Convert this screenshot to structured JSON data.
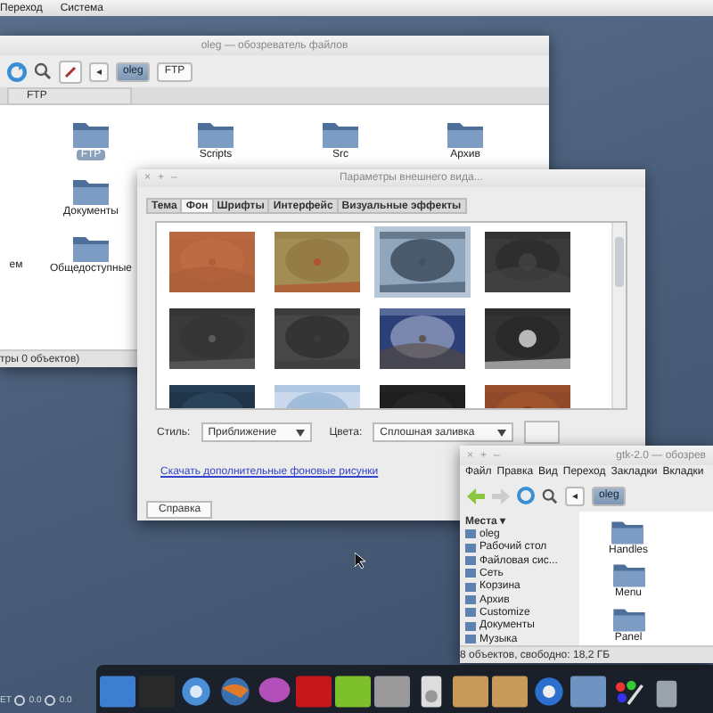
{
  "top_panel": {
    "menus": [
      "Переход",
      "Система"
    ]
  },
  "file_window": {
    "title": "oleg — обозреватель файлов",
    "path_buttons": [
      {
        "label": "◂",
        "selected": false
      },
      {
        "label": "oleg",
        "selected": true
      },
      {
        "label": "FTP",
        "selected": false
      }
    ],
    "tabs": [
      {
        "label": "FTP",
        "selected": true
      }
    ],
    "columns": [
      [
        {
          "label": "ем",
          "selected": false
        }
      ],
      [
        {
          "label": "FTP",
          "selected": true
        },
        {
          "label": "Документы",
          "selected": false
        },
        {
          "label": "Общедоступные",
          "selected": false
        }
      ],
      [
        {
          "label": "Scripts",
          "selected": false
        }
      ],
      [
        {
          "label": "Src",
          "selected": false
        }
      ],
      [
        {
          "label": "Архив",
          "selected": false
        }
      ]
    ],
    "status": "тры 0 объектов)"
  },
  "appearance_dialog": {
    "title": "Параметры внешнего вида...",
    "controls": [
      "×",
      "+",
      "–"
    ],
    "tabs": [
      {
        "label": "Тема",
        "selected": false
      },
      {
        "label": "Фон",
        "selected": true
      },
      {
        "label": "Шрифты",
        "selected": false
      },
      {
        "label": "Интерфейс",
        "selected": false
      },
      {
        "label": "Визуальные эффекты",
        "selected": false
      }
    ],
    "backgrounds": [
      {
        "selected": false
      },
      {
        "selected": false
      },
      {
        "selected": true
      },
      {
        "selected": false
      },
      {
        "selected": false
      },
      {
        "selected": false
      },
      {
        "selected": false
      },
      {
        "selected": false
      },
      {
        "selected": false
      },
      {
        "selected": false
      },
      {
        "selected": false
      },
      {
        "selected": false
      }
    ],
    "style_label": "Стиль:",
    "style_value": "Приближение",
    "colors_label": "Цвета:",
    "colors_value": "Сплошная заливка",
    "link": "Скачать дополнительные фоновые рисунки",
    "help_button": "Справка"
  },
  "gtk_window": {
    "title": "gtk-2.0 — обозрев",
    "controls": [
      "×",
      "+",
      "–"
    ],
    "menus": [
      "Файл",
      "Правка",
      "Вид",
      "Переход",
      "Закладки",
      "Вкладки"
    ],
    "path_buttons": [
      {
        "label": "◂",
        "selected": false
      },
      {
        "label": "oleg",
        "selected": true
      }
    ],
    "places_heading": "Места ▾",
    "places": [
      "oleg",
      "Рабочий стол",
      "Файловая сис...",
      "Сеть",
      "Корзина",
      "Архив",
      "Customize",
      "Документы",
      "Музыка"
    ],
    "folders": [
      "Handles",
      "Menu",
      "Panel"
    ],
    "status": "8 объектов, свободно: 18,2 ГБ"
  },
  "tray": {
    "texts": [
      "ЕТ",
      "0.0",
      "0.0"
    ]
  }
}
